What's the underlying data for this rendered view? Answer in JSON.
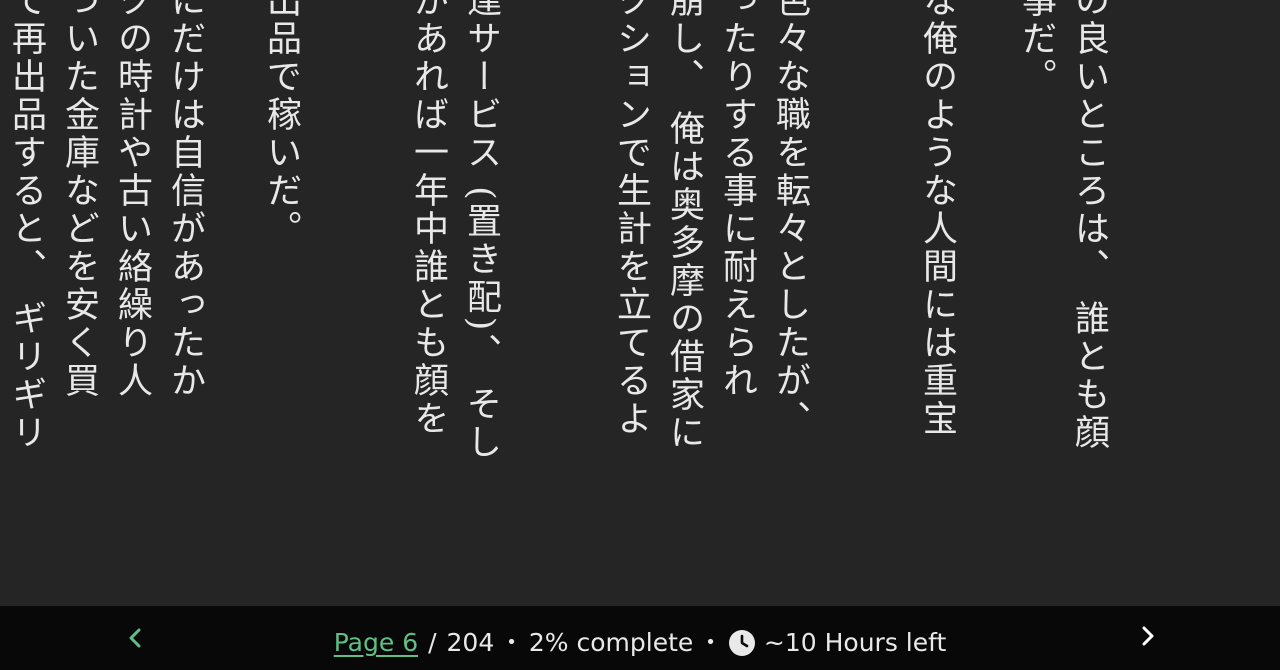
{
  "reader": {
    "columns": [
      "の良いところは、 誰とも顔",
      "事だ。",
      "な俺のような人間には重宝",
      "色々な職を転々としたが、",
      "ったりする事に耐えられ",
      "崩し、 俺は奥多摩の借家に",
      "クションで生計を立てるよ",
      "達サービス (置き配)、 そし",
      "があれば一年中誰とも顔を",
      "。",
      "出品で稼いだ。",
      "にだけは自信があったか",
      "クの時計や古い絡繰り人",
      "ついた金庫などを安く買",
      "て再出品すると、 ギリギリ"
    ]
  },
  "bottom_bar": {
    "page_label": "Page 6",
    "separator": "/",
    "total_pages": "204",
    "bullet": "•",
    "percent_text": "2% complete",
    "time_left": "~10 Hours left",
    "accent_color": "#5fbf86",
    "prev_icon": "chevron-left-icon",
    "next_icon": "chevron-right-icon",
    "clock_icon": "clock-icon"
  }
}
